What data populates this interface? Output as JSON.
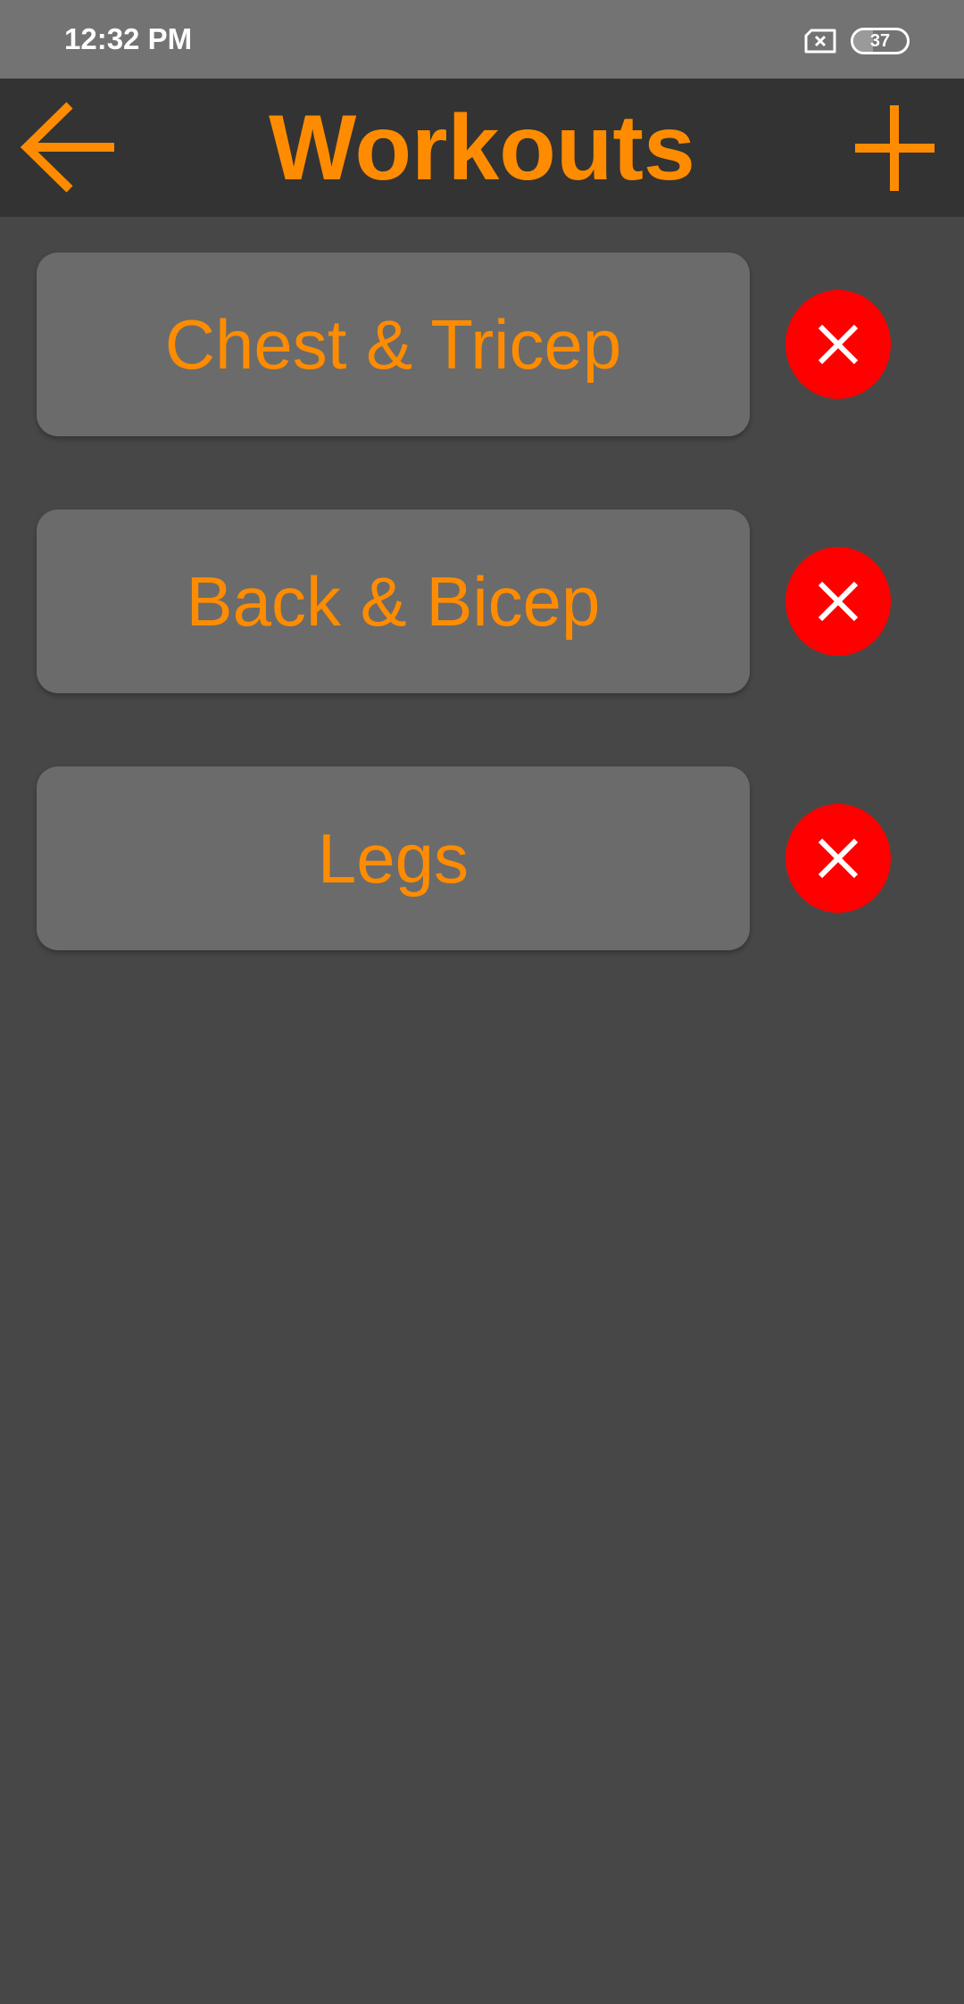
{
  "status_bar": {
    "time": "12:32 PM",
    "battery": "37",
    "battery_level": 0.37
  },
  "header": {
    "title": "Workouts",
    "back_icon": "arrow-left-icon",
    "add_icon": "plus-icon"
  },
  "workouts": [
    {
      "label": "Chest & Tricep"
    },
    {
      "label": "Back & Bicep"
    },
    {
      "label": "Legs"
    }
  ],
  "colors": {
    "accent": "#ff8c00",
    "delete": "#ff0000",
    "background": "#474747",
    "app_bar": "#333333",
    "card": "#6b6b6b",
    "status_bar": "#737373"
  },
  "icons": {
    "delete": "close-icon",
    "sim": "sim-card-icon",
    "battery": "battery-icon"
  }
}
